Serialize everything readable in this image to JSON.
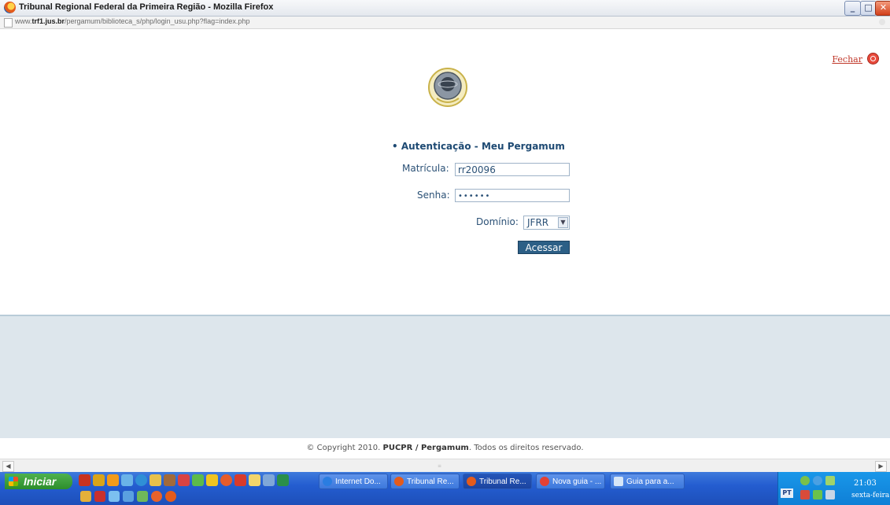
{
  "window": {
    "title": "Tribunal Regional Federal da Primeira Região - Mozilla Firefox",
    "controls": [
      "minimize",
      "maximize",
      "close"
    ]
  },
  "urlbar": {
    "prefix": "www.",
    "domain": "trf1.jus.br",
    "path": "/pergamum/biblioteca_s/php/login_usu.php?flag=index.php"
  },
  "page": {
    "close_label": "Fechar",
    "heading": "• Autenticação - Meu Pergamum",
    "matricula_label": "Matrícula:",
    "matricula_value": "rr20096",
    "senha_label": "Senha:",
    "senha_value": "••••••",
    "dominio_label": "Domínio:",
    "dominio_value": "JFRR",
    "submit_label": "Acessar"
  },
  "footer": {
    "copyright_prefix": "© Copyright 2010.",
    "copyright_brand": "PUCPR / Pergamum",
    "copyright_suffix": ". Todos os direitos reservado."
  },
  "taskbar": {
    "start_label": "Iniciar",
    "tasks": [
      {
        "label": "Internet Do...",
        "icon": "ie-icon",
        "color": "#2a7de1"
      },
      {
        "label": "Tribunal Re...",
        "icon": "firefox-icon",
        "color": "#e35b1c"
      },
      {
        "label": "Tribunal Re...",
        "icon": "firefox-icon",
        "color": "#e35b1c",
        "active": true
      },
      {
        "label": "Nova guia - ...",
        "icon": "chrome-icon",
        "color": "#e34133"
      },
      {
        "label": "Guia para a...",
        "icon": "document-icon",
        "color": "#d6e6f7"
      }
    ],
    "tray": {
      "language": "PT",
      "time": "21:03",
      "day": "sexta-feira"
    }
  },
  "colors": {
    "heading": "#1e4a73",
    "button": "#2c5f86",
    "footer_band": "#dde6ec",
    "close_link": "#c0392b"
  }
}
